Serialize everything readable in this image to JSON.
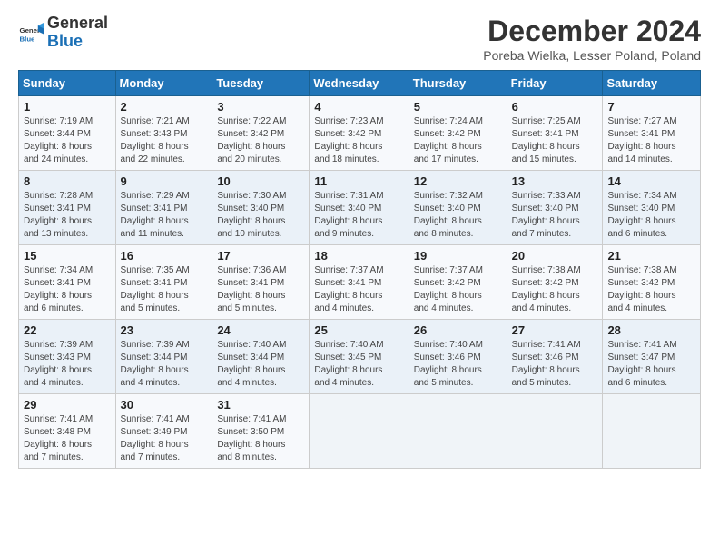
{
  "header": {
    "logo_line1": "General",
    "logo_line2": "Blue",
    "title": "December 2024",
    "subtitle": "Poreba Wielka, Lesser Poland, Poland"
  },
  "weekdays": [
    "Sunday",
    "Monday",
    "Tuesday",
    "Wednesday",
    "Thursday",
    "Friday",
    "Saturday"
  ],
  "weeks": [
    [
      {
        "day": "1",
        "sunrise": "7:19 AM",
        "sunset": "3:44 PM",
        "daylight": "8 hours and 24 minutes."
      },
      {
        "day": "2",
        "sunrise": "7:21 AM",
        "sunset": "3:43 PM",
        "daylight": "8 hours and 22 minutes."
      },
      {
        "day": "3",
        "sunrise": "7:22 AM",
        "sunset": "3:42 PM",
        "daylight": "8 hours and 20 minutes."
      },
      {
        "day": "4",
        "sunrise": "7:23 AM",
        "sunset": "3:42 PM",
        "daylight": "8 hours and 18 minutes."
      },
      {
        "day": "5",
        "sunrise": "7:24 AM",
        "sunset": "3:42 PM",
        "daylight": "8 hours and 17 minutes."
      },
      {
        "day": "6",
        "sunrise": "7:25 AM",
        "sunset": "3:41 PM",
        "daylight": "8 hours and 15 minutes."
      },
      {
        "day": "7",
        "sunrise": "7:27 AM",
        "sunset": "3:41 PM",
        "daylight": "8 hours and 14 minutes."
      }
    ],
    [
      {
        "day": "8",
        "sunrise": "7:28 AM",
        "sunset": "3:41 PM",
        "daylight": "8 hours and 13 minutes."
      },
      {
        "day": "9",
        "sunrise": "7:29 AM",
        "sunset": "3:41 PM",
        "daylight": "8 hours and 11 minutes."
      },
      {
        "day": "10",
        "sunrise": "7:30 AM",
        "sunset": "3:40 PM",
        "daylight": "8 hours and 10 minutes."
      },
      {
        "day": "11",
        "sunrise": "7:31 AM",
        "sunset": "3:40 PM",
        "daylight": "8 hours and 9 minutes."
      },
      {
        "day": "12",
        "sunrise": "7:32 AM",
        "sunset": "3:40 PM",
        "daylight": "8 hours and 8 minutes."
      },
      {
        "day": "13",
        "sunrise": "7:33 AM",
        "sunset": "3:40 PM",
        "daylight": "8 hours and 7 minutes."
      },
      {
        "day": "14",
        "sunrise": "7:34 AM",
        "sunset": "3:40 PM",
        "daylight": "8 hours and 6 minutes."
      }
    ],
    [
      {
        "day": "15",
        "sunrise": "7:34 AM",
        "sunset": "3:41 PM",
        "daylight": "8 hours and 6 minutes."
      },
      {
        "day": "16",
        "sunrise": "7:35 AM",
        "sunset": "3:41 PM",
        "daylight": "8 hours and 5 minutes."
      },
      {
        "day": "17",
        "sunrise": "7:36 AM",
        "sunset": "3:41 PM",
        "daylight": "8 hours and 5 minutes."
      },
      {
        "day": "18",
        "sunrise": "7:37 AM",
        "sunset": "3:41 PM",
        "daylight": "8 hours and 4 minutes."
      },
      {
        "day": "19",
        "sunrise": "7:37 AM",
        "sunset": "3:42 PM",
        "daylight": "8 hours and 4 minutes."
      },
      {
        "day": "20",
        "sunrise": "7:38 AM",
        "sunset": "3:42 PM",
        "daylight": "8 hours and 4 minutes."
      },
      {
        "day": "21",
        "sunrise": "7:38 AM",
        "sunset": "3:42 PM",
        "daylight": "8 hours and 4 minutes."
      }
    ],
    [
      {
        "day": "22",
        "sunrise": "7:39 AM",
        "sunset": "3:43 PM",
        "daylight": "8 hours and 4 minutes."
      },
      {
        "day": "23",
        "sunrise": "7:39 AM",
        "sunset": "3:44 PM",
        "daylight": "8 hours and 4 minutes."
      },
      {
        "day": "24",
        "sunrise": "7:40 AM",
        "sunset": "3:44 PM",
        "daylight": "8 hours and 4 minutes."
      },
      {
        "day": "25",
        "sunrise": "7:40 AM",
        "sunset": "3:45 PM",
        "daylight": "8 hours and 4 minutes."
      },
      {
        "day": "26",
        "sunrise": "7:40 AM",
        "sunset": "3:46 PM",
        "daylight": "8 hours and 5 minutes."
      },
      {
        "day": "27",
        "sunrise": "7:41 AM",
        "sunset": "3:46 PM",
        "daylight": "8 hours and 5 minutes."
      },
      {
        "day": "28",
        "sunrise": "7:41 AM",
        "sunset": "3:47 PM",
        "daylight": "8 hours and 6 minutes."
      }
    ],
    [
      {
        "day": "29",
        "sunrise": "7:41 AM",
        "sunset": "3:48 PM",
        "daylight": "8 hours and 7 minutes."
      },
      {
        "day": "30",
        "sunrise": "7:41 AM",
        "sunset": "3:49 PM",
        "daylight": "8 hours and 7 minutes."
      },
      {
        "day": "31",
        "sunrise": "7:41 AM",
        "sunset": "3:50 PM",
        "daylight": "8 hours and 8 minutes."
      },
      null,
      null,
      null,
      null
    ]
  ]
}
